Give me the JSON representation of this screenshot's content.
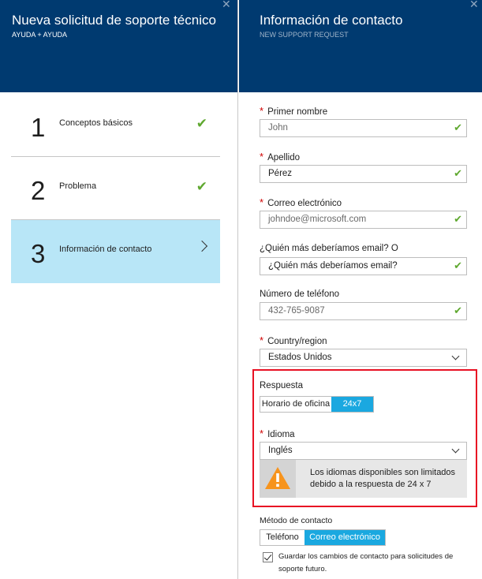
{
  "left_blade": {
    "title": "Nueva solicitud de soporte técnico",
    "subtitle": "AYUDA + AYUDA",
    "close": "✕",
    "steps": [
      {
        "number": "1",
        "label": "Conceptos básicos",
        "status": "complete"
      },
      {
        "number": "2",
        "label": "Problema",
        "status": "complete"
      },
      {
        "number": "3",
        "label": "Información de contacto",
        "status": "active"
      }
    ]
  },
  "right_blade": {
    "title": "Información de contacto",
    "subtitle": "NEW SUPPORT REQUEST",
    "close": "✕",
    "required_mark": "*",
    "fields": {
      "first_name": {
        "label": "Primer nombre",
        "value": "John"
      },
      "last_name": {
        "label": "Apellido",
        "value": "Pérez"
      },
      "email": {
        "label": "Correo electrónico",
        "value": "johndoe@microsoft.com"
      },
      "cc_email": {
        "label": "¿Quién más deberíamos email? O",
        "value": "¿Quién más deberíamos email?"
      },
      "phone": {
        "label": "Número de teléfono",
        "value": "432-765-9087"
      },
      "country": {
        "label": "Country/region",
        "value": "Estados Unidos"
      }
    },
    "response": {
      "label": "Respuesta",
      "options": [
        "Horario de oficina",
        "24x7"
      ],
      "selected": "24x7"
    },
    "language": {
      "label": "Idioma",
      "value": "Inglés",
      "warning": "Los idiomas disponibles son limitados debido a la respuesta de 24 x 7"
    },
    "contact_method": {
      "label": "Método de contacto",
      "options": [
        "Teléfono",
        "Correo electrónico"
      ],
      "selected": "Correo electrónico"
    },
    "save_changes": {
      "label": "Guardar los cambios de contacto para solicitudes de soporte futuro.",
      "checked": true
    }
  },
  "colors": {
    "header_bg": "#003a70",
    "active_step_bg": "#b8e6f7",
    "toggle_on": "#1aa8e0",
    "check_green": "#5fa82f",
    "required_red": "#d00000",
    "highlight_border": "#e81123",
    "warning_orange": "#f7941d"
  }
}
